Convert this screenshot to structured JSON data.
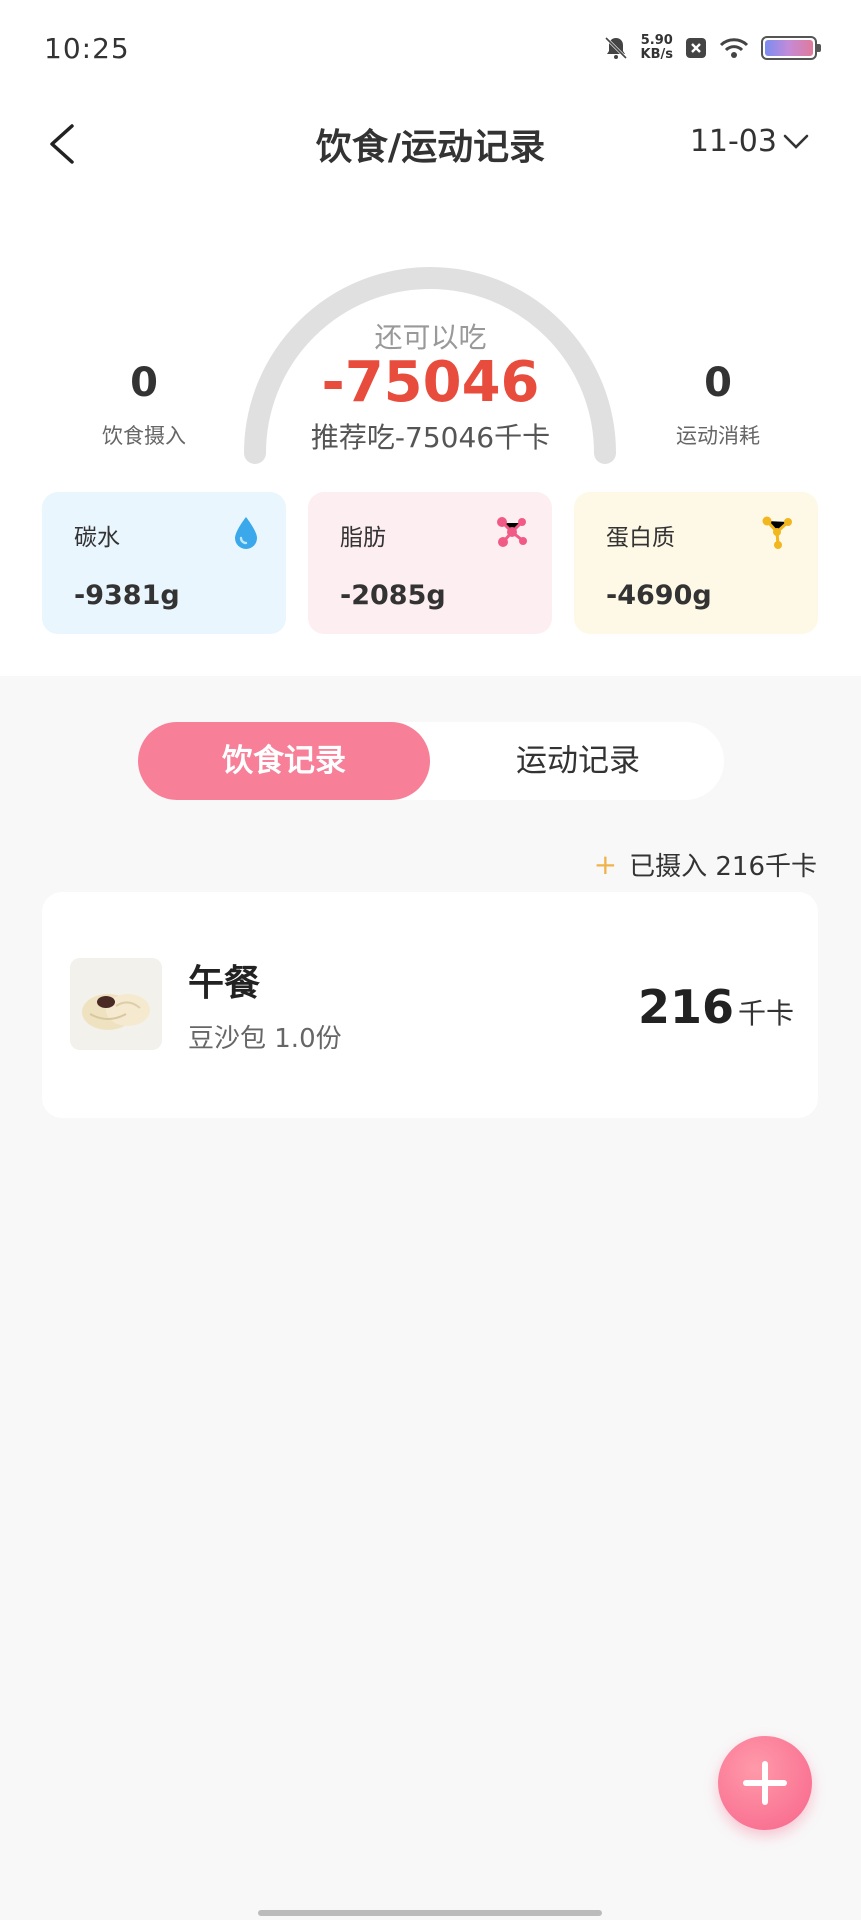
{
  "status": {
    "time": "10:25",
    "net_speed": "5.90",
    "net_unit": "KB/s"
  },
  "header": {
    "title": "饮食/运动记录",
    "date": "11-03"
  },
  "summary": {
    "remaining_label": "还可以吃",
    "remaining_value": "-75046",
    "recommend": "推荐吃-75046千卡",
    "intake_value": "0",
    "intake_label": "饮食摄入",
    "burn_value": "0",
    "burn_label": "运动消耗"
  },
  "macros": {
    "carb": {
      "name": "碳水",
      "value": "-9381g",
      "icon": "water-drop-icon"
    },
    "fat": {
      "name": "脂肪",
      "value": "-2085g",
      "icon": "fat-molecule-icon"
    },
    "protein": {
      "name": "蛋白质",
      "value": "-4690g",
      "icon": "protein-molecule-icon"
    }
  },
  "tabs": {
    "diet": "饮食记录",
    "sport": "运动记录"
  },
  "intake_total": {
    "prefix": "+",
    "text": "已摄入 216千卡"
  },
  "meal": {
    "name": "午餐",
    "desc": "豆沙包 1.0份",
    "kcal": "216",
    "unit": "千卡"
  },
  "colors": {
    "accent": "#f77f97",
    "remaining": "#e84c3d"
  }
}
